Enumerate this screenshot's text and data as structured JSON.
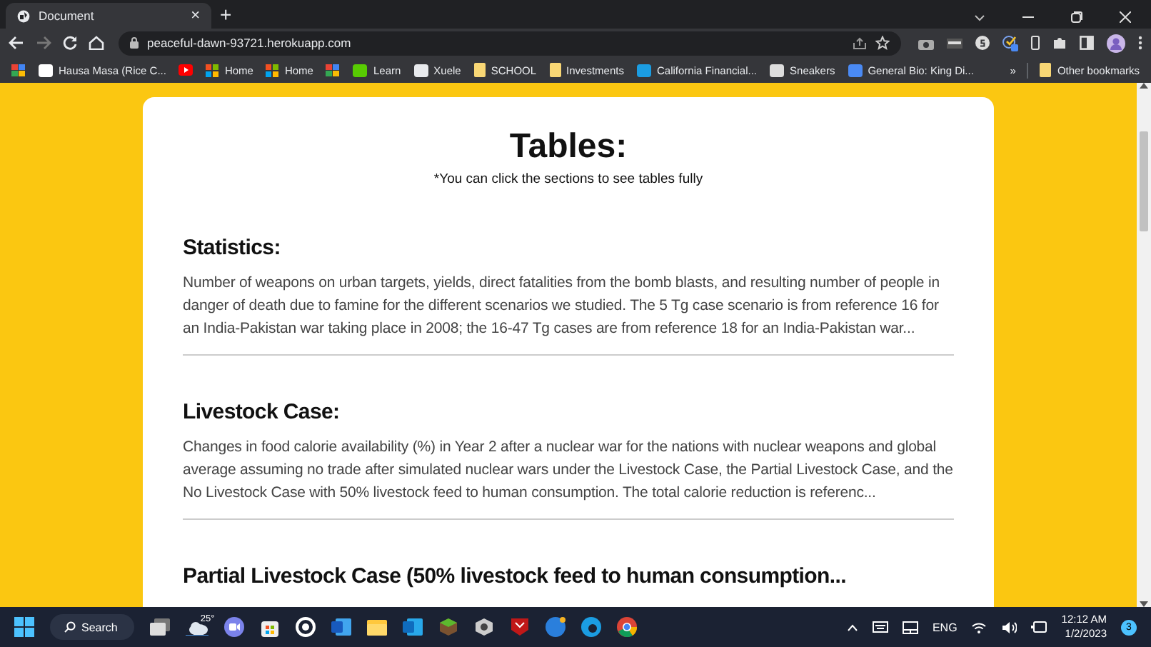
{
  "browser": {
    "tab": {
      "title": "Document",
      "selected": true
    },
    "close": "×",
    "new_tab": "+",
    "url": "peaceful-dawn-93721.herokuapp.com",
    "bookmarks": [
      {
        "kind": "icon"
      },
      {
        "kind": "link",
        "label": "Hausa Masa (Rice C..."
      },
      {
        "kind": "icon"
      },
      {
        "kind": "link",
        "label": "Home"
      },
      {
        "kind": "link",
        "label": "Home"
      },
      {
        "kind": "icon"
      },
      {
        "kind": "link",
        "label": "Learn"
      },
      {
        "kind": "link",
        "label": "Xuele"
      },
      {
        "kind": "folder",
        "label": "SCHOOL"
      },
      {
        "kind": "folder",
        "label": "Investments"
      },
      {
        "kind": "link",
        "label": "California Financial..."
      },
      {
        "kind": "link",
        "label": "Sneakers"
      },
      {
        "kind": "link",
        "label": "General Bio: King Di..."
      }
    ],
    "overflow": "»",
    "other_bookmarks": "Other bookmarks"
  },
  "page": {
    "title": "Tables:",
    "note": "*You can click the sections to see tables fully",
    "sections": [
      {
        "heading": "Statistics:",
        "text": "Number of weapons on urban targets, yields, direct fatalities from the bomb blasts, and resulting number of people in danger of death due to famine for the different scenarios we studied. The 5 Tg case scenario is from reference 16 for an India-Pakistan war taking place in 2008; the 16-47 Tg cases are from reference 18 for an India-Pakistan war..."
      },
      {
        "heading": "Livestock Case:",
        "text": "Changes in food calorie availability (%) in Year 2 after a nuclear war for the nations with nuclear weapons and global average assuming no trade after simulated nuclear wars under the Livestock Case, the Partial Livestock Case, and the No Livestock Case with 50% livestock feed to human consumption. The total calorie reduction is referenc..."
      },
      {
        "heading": "Partial Livestock Case (50% livestock feed to human consumption..."
      }
    ]
  },
  "taskbar": {
    "search": "Search",
    "weather": "25°",
    "language": "ENG",
    "time": "12:12 AM",
    "date": "1/2/2023",
    "notifications": "3"
  }
}
